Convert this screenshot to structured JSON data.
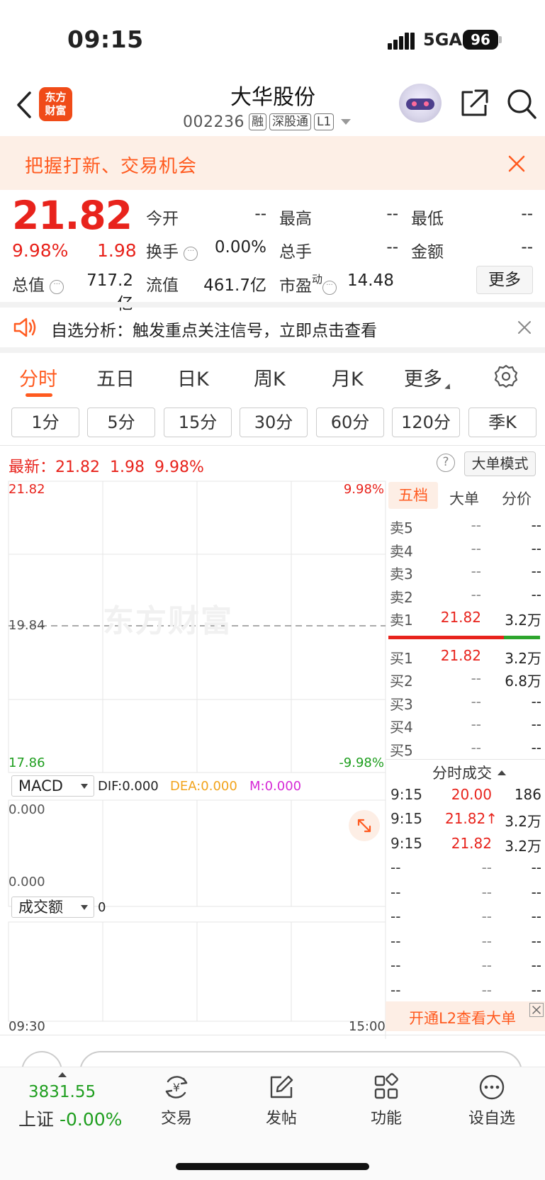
{
  "status_bar": {
    "time": "09:15",
    "network": "5GA",
    "battery": "96"
  },
  "header": {
    "logo_line1": "东方",
    "logo_line2": "财富",
    "stock_name": "大华股份",
    "stock_code": "002236",
    "tags": [
      "融",
      "深股通",
      "L1"
    ]
  },
  "promo": {
    "text": "把握打新、交易机会"
  },
  "quote": {
    "price": "21.82",
    "change_pct": "9.98%",
    "change": "1.98",
    "metrics": [
      {
        "label": "今开",
        "value": "--"
      },
      {
        "label": "最高",
        "value": "--"
      },
      {
        "label": "最低",
        "value": "--"
      },
      {
        "label": "换手",
        "value": "0.00%"
      },
      {
        "label": "总手",
        "value": "--"
      },
      {
        "label": "金额",
        "value": "--"
      },
      {
        "label": "总值",
        "value": "717.2亿"
      },
      {
        "label": "流值",
        "value": "461.7亿"
      },
      {
        "label": "市盈",
        "value": "14.48"
      }
    ],
    "pe_superscript": "动",
    "more_label": "更多"
  },
  "analysis": {
    "text": "自选分析：触发重点关注信号，立即点击查看"
  },
  "tabs": [
    "分时",
    "五日",
    "日K",
    "周K",
    "月K",
    "更多"
  ],
  "periods": [
    "1分",
    "5分",
    "15分",
    "30分",
    "60分",
    "120分",
    "季K"
  ],
  "latest": {
    "label": "最新：",
    "price": "21.82",
    "change": "1.98",
    "pct": "9.98%",
    "big_order_mode": "大单模式"
  },
  "chart": {
    "y_max": "21.82",
    "y_mid": "19.84",
    "y_min": "17.86",
    "pct_max": "9.98%",
    "pct_min": "-9.98%",
    "watermark": "东方财富",
    "time_start": "09:30",
    "time_end": "15:00",
    "macd_label": "MACD",
    "dif": "DIF:0.000",
    "dea": "DEA:0.000",
    "m": "M:0.000",
    "macd_top": "0.000",
    "macd_bottom": "0.000",
    "vol_label": "成交额",
    "vol_value": "0"
  },
  "order_book": {
    "tabs": [
      "五档",
      "大单",
      "分价"
    ],
    "asks": [
      {
        "label": "卖5",
        "price": "--",
        "vol": "--"
      },
      {
        "label": "卖4",
        "price": "--",
        "vol": "--"
      },
      {
        "label": "卖3",
        "price": "--",
        "vol": "--"
      },
      {
        "label": "卖2",
        "price": "--",
        "vol": "--"
      },
      {
        "label": "卖1",
        "price": "21.82",
        "vol": "3.2万"
      }
    ],
    "bids": [
      {
        "label": "买1",
        "price": "21.82",
        "vol": "3.2万"
      },
      {
        "label": "买2",
        "price": "--",
        "vol": "6.8万"
      },
      {
        "label": "买3",
        "price": "--",
        "vol": "--"
      },
      {
        "label": "买4",
        "price": "--",
        "vol": "--"
      },
      {
        "label": "买5",
        "price": "--",
        "vol": "--"
      }
    ]
  },
  "fenshi": {
    "title": "分时成交",
    "rows": [
      {
        "time": "9:15",
        "price": "20.00",
        "vol": "186"
      },
      {
        "time": "9:15",
        "price": "21.82↑",
        "vol": "3.2万"
      },
      {
        "time": "9:15",
        "price": "21.82",
        "vol": "3.2万"
      },
      {
        "time": "--",
        "price": "--",
        "vol": "--"
      },
      {
        "time": "--",
        "price": "--",
        "vol": "--"
      },
      {
        "time": "--",
        "price": "--",
        "vol": "--"
      },
      {
        "time": "--",
        "price": "--",
        "vol": "--"
      },
      {
        "time": "--",
        "price": "--",
        "vol": "--"
      },
      {
        "time": "--",
        "price": "--",
        "vol": "--"
      }
    ],
    "l2_promo": "开通L2查看大单"
  },
  "bottom_nav": {
    "index_value": "3831.55",
    "index_name": "上证",
    "index_change": "-0.00%",
    "items": [
      "交易",
      "发帖",
      "功能",
      "设自选"
    ]
  },
  "colors": {
    "up": "#e8231c",
    "down": "#1e9e1e",
    "accent": "#ff5a1f"
  }
}
